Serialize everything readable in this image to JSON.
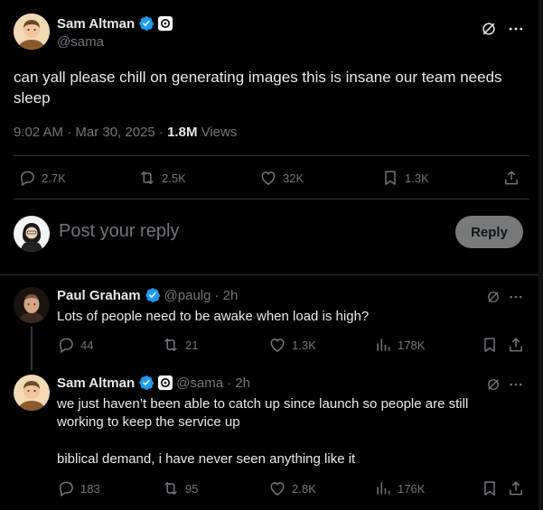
{
  "main": {
    "author_name": "Sam Altman",
    "author_handle": "@sama",
    "text": "can yall please chill on generating images this is insane our team needs sleep",
    "time": "9:02 AM · Mar 30, 2025 · ",
    "views_count": "1.8M",
    "views_label": " Views",
    "stats": {
      "replies": "2.7K",
      "reposts": "2.5K",
      "likes": "32K",
      "bookmarks": "1.3K"
    }
  },
  "composer": {
    "placeholder": "Post your reply",
    "button": "Reply"
  },
  "replies": [
    {
      "author_name": "Paul Graham",
      "author_handle": "@paulg",
      "time": "· 2h",
      "text": "Lots of people need to be awake when load is high?",
      "stats": {
        "replies": "44",
        "reposts": "21",
        "likes": "1.3K",
        "views": "178K"
      }
    },
    {
      "author_name": "Sam Altman",
      "author_handle": "@sama",
      "time": "· 2h",
      "text1": "we just haven’t been able to catch up since launch so people are still working to keep the service up",
      "text2": "biblical demand, i have never seen anything like it",
      "stats": {
        "replies": "183",
        "reposts": "95",
        "likes": "2.8K",
        "views": "176K"
      }
    }
  ],
  "colors": {
    "verified": "#1d9bf0",
    "background": "#000000",
    "muted": "#71767b",
    "reply_button": "#787a7a"
  }
}
